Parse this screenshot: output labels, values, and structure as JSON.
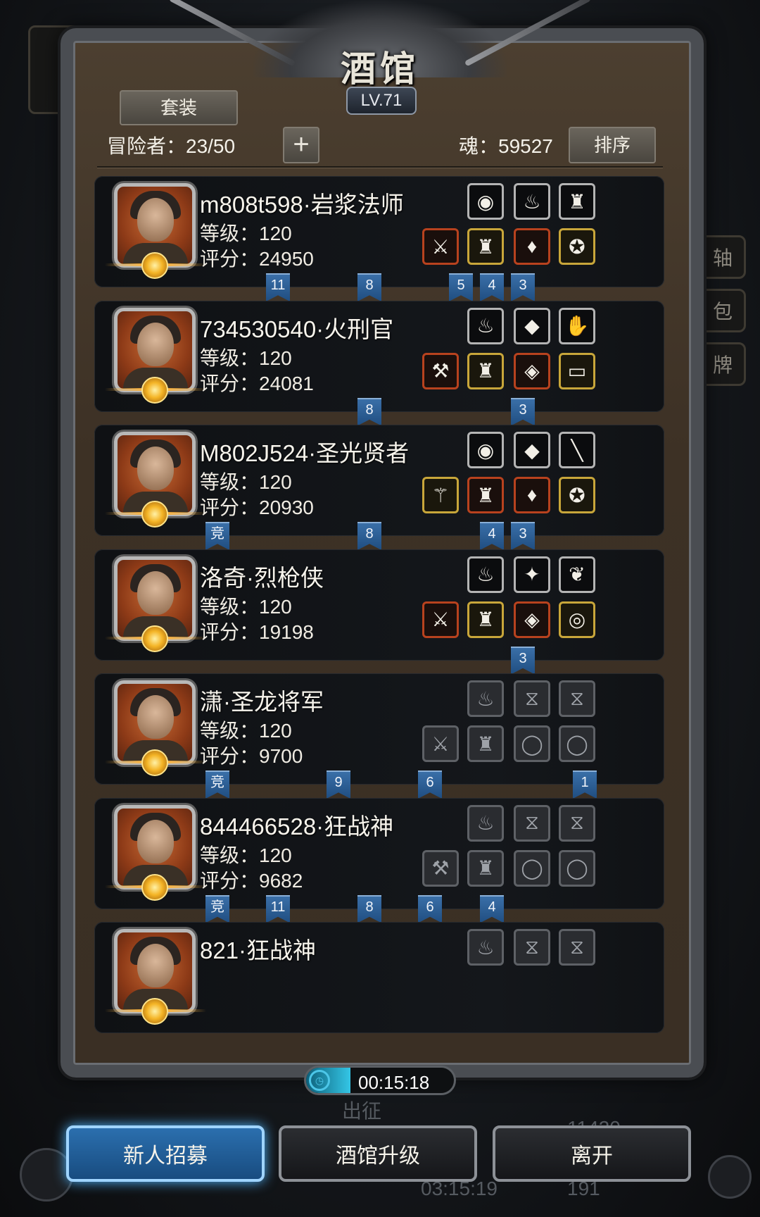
{
  "header": {
    "title": "酒馆",
    "level": "LV.71",
    "set_button": "套装",
    "adventurers": "冒险者：23/50",
    "add_button": "+",
    "soul": "魂：59527",
    "sort_button": "排序"
  },
  "side_labels": [
    "轴",
    "包",
    "牌"
  ],
  "heroes": [
    {
      "name": "m808t598·岩浆法师",
      "level": "等级：120",
      "score": "评分：24950",
      "top": [
        {
          "kind": "top",
          "icon": "blue-orb-icon",
          "g": "◉"
        },
        {
          "kind": "top",
          "icon": "red-pouch-icon",
          "g": "♨"
        },
        {
          "kind": "top",
          "icon": "lantern-icon",
          "g": "♜"
        }
      ],
      "bottom": [
        {
          "kind": "red",
          "icon": "scythe-icon",
          "g": "⚔"
        },
        {
          "kind": "gold",
          "icon": "robe-icon",
          "g": "♜"
        },
        {
          "kind": "red",
          "icon": "amulet-icon",
          "g": "♦"
        },
        {
          "kind": "gold",
          "icon": "pendant-icon",
          "g": "✪"
        }
      ],
      "ribbons": [
        {
          "text": "11"
        },
        {
          "text": "8"
        },
        {
          "text": "5"
        },
        {
          "text": "4"
        },
        {
          "text": "3"
        }
      ]
    },
    {
      "name": "734530540·火刑官",
      "level": "等级：120",
      "score": "评分：24081",
      "top": [
        {
          "kind": "top",
          "icon": "fire-icon",
          "g": "♨"
        },
        {
          "kind": "top",
          "icon": "red-gem-icon",
          "g": "◆"
        },
        {
          "kind": "top",
          "icon": "gauntlet-icon",
          "g": "✋"
        }
      ],
      "bottom": [
        {
          "kind": "red",
          "icon": "axe-icon",
          "g": "⚒"
        },
        {
          "kind": "gold",
          "icon": "armor-icon",
          "g": "♜"
        },
        {
          "kind": "red",
          "icon": "purple-helm-icon",
          "g": "◈"
        },
        {
          "kind": "gold",
          "icon": "belt-icon",
          "g": "▭"
        }
      ],
      "ribbons": [
        {
          "text": "8"
        },
        {
          "text": "3"
        }
      ]
    },
    {
      "name": "M802J524·圣光贤者",
      "level": "等级：120",
      "score": "评分：20930",
      "top": [
        {
          "kind": "top",
          "icon": "green-orb-icon",
          "g": "◉"
        },
        {
          "kind": "top",
          "icon": "purple-gem-icon",
          "g": "◆"
        },
        {
          "kind": "top",
          "icon": "staff-icon",
          "g": "╲"
        }
      ],
      "bottom": [
        {
          "kind": "gold",
          "icon": "scepter-icon",
          "g": "⚚"
        },
        {
          "kind": "red",
          "icon": "vestment-icon",
          "g": "♜"
        },
        {
          "kind": "red",
          "icon": "red-amulet-icon",
          "g": "♦"
        },
        {
          "kind": "gold",
          "icon": "blue-pendant-icon",
          "g": "✪"
        }
      ],
      "ribbons": [
        {
          "text": "竞"
        },
        {
          "text": "8"
        },
        {
          "text": "4"
        },
        {
          "text": "3"
        }
      ]
    },
    {
      "name": "洛奇·烈枪侠",
      "level": "等级：120",
      "score": "评分：19198",
      "top": [
        {
          "kind": "top",
          "icon": "fire-icon",
          "g": "♨"
        },
        {
          "kind": "top",
          "icon": "emblem-icon",
          "g": "✦"
        },
        {
          "kind": "top",
          "icon": "feather-icon",
          "g": "❦"
        }
      ],
      "bottom": [
        {
          "kind": "red",
          "icon": "rifle-icon",
          "g": "⚔"
        },
        {
          "kind": "gold",
          "icon": "chestplate-icon",
          "g": "♜"
        },
        {
          "kind": "red",
          "icon": "demon-helm-icon",
          "g": "◈"
        },
        {
          "kind": "gold",
          "icon": "ring-icon",
          "g": "◎"
        }
      ],
      "ribbons": [
        {
          "text": "3"
        }
      ]
    },
    {
      "name": "潇·圣龙将军",
      "level": "等级：120",
      "score": "评分：9700",
      "top": [
        {
          "kind": "empty",
          "icon": "empty-flame-slot-icon",
          "g": "♨"
        },
        {
          "kind": "empty",
          "icon": "empty-hourglass-slot-icon",
          "g": "⧖"
        },
        {
          "kind": "empty",
          "icon": "empty-hourglass-slot-icon",
          "g": "⧖"
        }
      ],
      "bottom": [
        {
          "kind": "empty",
          "icon": "empty-sword-slot-icon",
          "g": "⚔"
        },
        {
          "kind": "empty",
          "icon": "empty-armor-slot-icon",
          "g": "♜"
        },
        {
          "kind": "empty",
          "icon": "empty-ring-slot-icon",
          "g": "◯"
        },
        {
          "kind": "empty",
          "icon": "empty-ring-slot-icon",
          "g": "◯"
        }
      ],
      "ribbons": [
        {
          "text": "竞"
        },
        {
          "text": "9"
        },
        {
          "text": "6"
        },
        {
          "text": "1"
        }
      ]
    },
    {
      "name": "844466528·狂战神",
      "level": "等级：120",
      "score": "评分：9682",
      "top": [
        {
          "kind": "empty",
          "icon": "empty-flame-slot-icon",
          "g": "♨"
        },
        {
          "kind": "empty",
          "icon": "empty-hourglass-slot-icon",
          "g": "⧖"
        },
        {
          "kind": "empty",
          "icon": "empty-hourglass-slot-icon",
          "g": "⧖"
        }
      ],
      "bottom": [
        {
          "kind": "empty",
          "icon": "empty-axe-slot-icon",
          "g": "⚒"
        },
        {
          "kind": "empty",
          "icon": "empty-armor-slot-icon",
          "g": "♜"
        },
        {
          "kind": "empty",
          "icon": "empty-ring-slot-icon",
          "g": "◯"
        },
        {
          "kind": "empty",
          "icon": "empty-ring-slot-icon",
          "g": "◯"
        }
      ],
      "ribbons": [
        {
          "text": "竞"
        },
        {
          "text": "11"
        },
        {
          "text": "8"
        },
        {
          "text": "6"
        },
        {
          "text": "4"
        }
      ]
    },
    {
      "name": "821·狂战神",
      "level": "",
      "score": "",
      "top": [
        {
          "kind": "empty",
          "icon": "empty-flame-slot-icon",
          "g": "♨"
        },
        {
          "kind": "empty",
          "icon": "empty-hourglass-slot-icon",
          "g": "⧖"
        },
        {
          "kind": "empty",
          "icon": "empty-hourglass-slot-icon",
          "g": "⧖"
        }
      ],
      "bottom": [],
      "ribbons": []
    }
  ],
  "timer": {
    "text": "00:15:18",
    "progress": 0.3
  },
  "behind": {
    "depart": "出征",
    "gold": "11420",
    "clock": "03:15:19",
    "gems": "191"
  },
  "buttons": {
    "recruit": "新人招募",
    "upgrade": "酒馆升级",
    "leave": "离开"
  }
}
